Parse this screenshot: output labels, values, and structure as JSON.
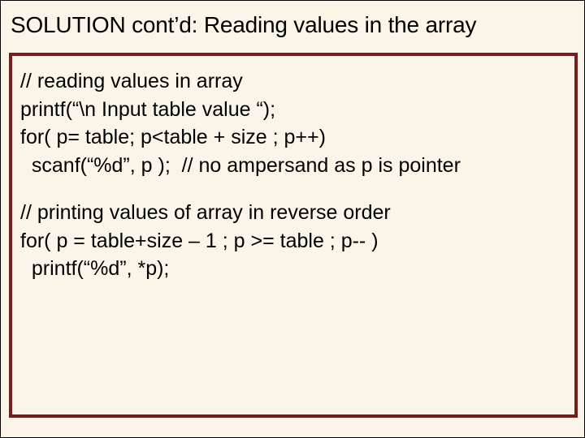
{
  "title_part1": "SOLUTION ",
  "title_contd": "cont’d:",
  "title_part2": " Reading values in the array",
  "block1": {
    "l1": "// reading values in array",
    "l2": "printf(“\\n Input table value “);",
    "l3": "for( p= table; p<table + size ; p++)",
    "l4": "  scanf(“%d”, p );  // no ampersand as p is pointer"
  },
  "block2": {
    "l1": "// printing values of array in reverse order",
    "l2": "for( p = table+size – 1 ; p >= table ; p-- )",
    "l3": "  printf(“%d”, *p);"
  }
}
